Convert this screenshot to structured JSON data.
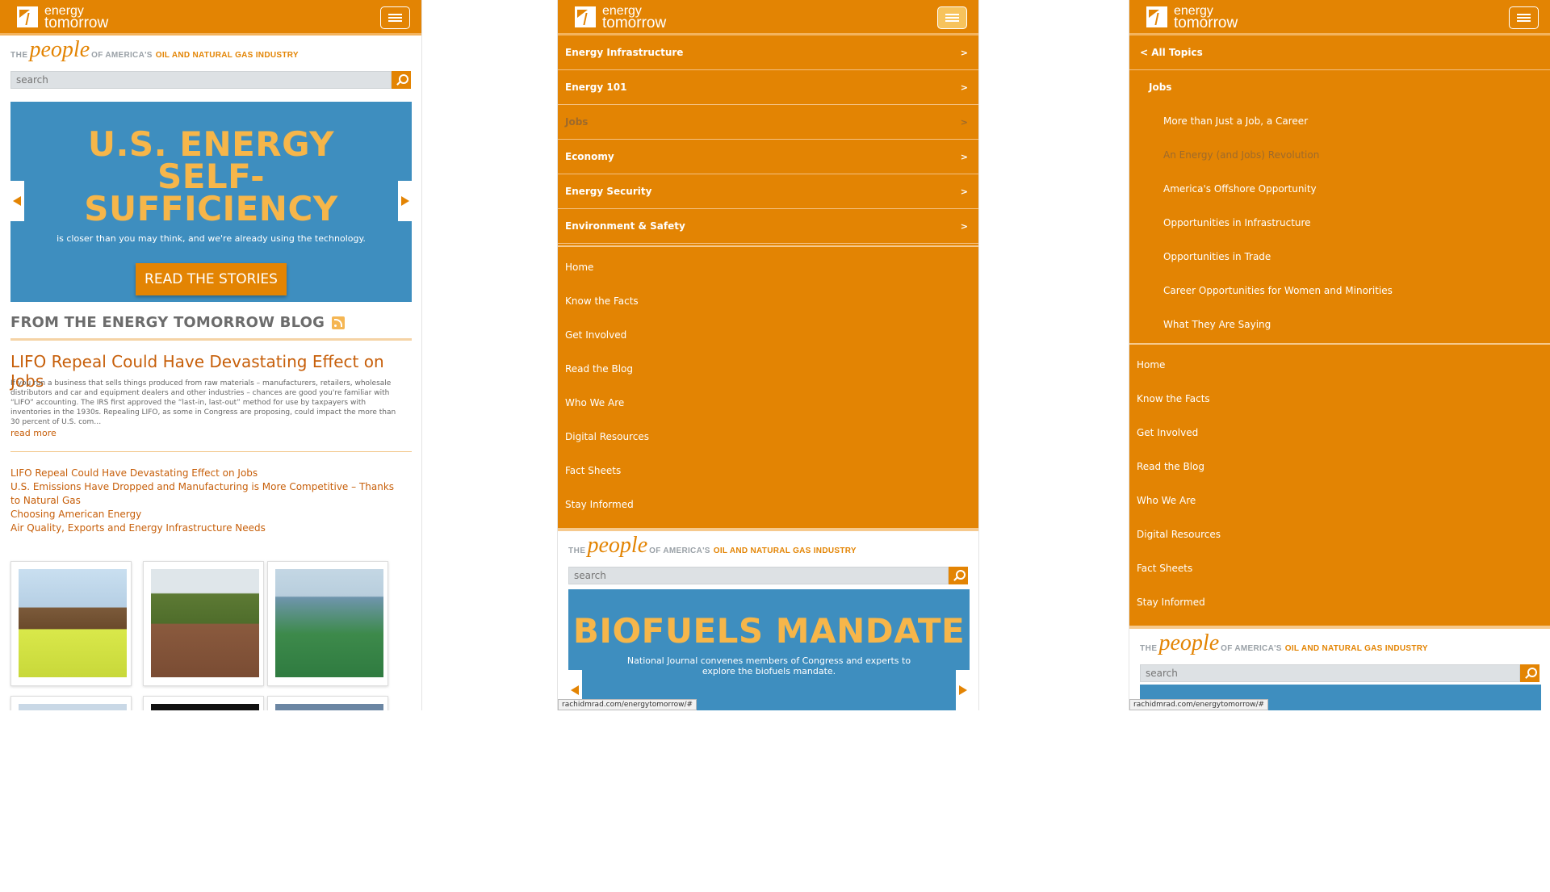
{
  "brand": {
    "line1": "energy",
    "line2": "tomorrow"
  },
  "tagline": {
    "the": "THE",
    "people": "people",
    "of": "OF AMERICA'S",
    "industry": "OIL AND NATURAL GAS INDUSTRY"
  },
  "search": {
    "placeholder": "search"
  },
  "panel1": {
    "hero": {
      "title": "U.S. ENERGY SELF-SUFFICIENCY",
      "subtitle": "is closer than you may think, and we're already using the technology.",
      "button": "READ THE STORIES"
    },
    "blog_heading": "FROM THE ENERGY TOMORROW BLOG",
    "post": {
      "title": "LIFO Repeal Could Have Devastating Effect on Jobs",
      "body": "If you run a business that sells things produced from raw materials – manufacturers, retailers, wholesale distributors and car and equipment dealers and other industries – chances are good you're familiar with “LIFO” accounting. The IRS first approved the “last-in, last-out” method for use by taxpayers with inventories in the 1930s. Repealing LIFO, as some in Congress are proposing, could impact the more than 30 percent of U.S. com…",
      "read_more": "read more"
    },
    "links": [
      "LIFO Repeal Could Have Devastating Effect on Jobs",
      "U.S. Emissions Have Dropped and Manufacturing is More Competitive – Thanks to Natural Gas",
      "Choosing American Energy",
      "Air Quality, Exports and Energy Infrastructure Needs"
    ]
  },
  "panel2": {
    "topics": [
      {
        "label": "Energy Infrastructure",
        "chev": ">"
      },
      {
        "label": "Energy 101",
        "chev": ">"
      },
      {
        "label": "Jobs",
        "chev": ">"
      },
      {
        "label": "Economy",
        "chev": ">"
      },
      {
        "label": "Energy Security",
        "chev": ">"
      },
      {
        "label": "Environment & Safety",
        "chev": ">"
      }
    ],
    "hero": {
      "title": "BIOFUELS MANDATE",
      "subtitle": "National Journal convenes members of Congress and experts to explore the biofuels mandate."
    },
    "status_url": "rachidmrad.com/energytomorrow/#"
  },
  "menu_items": [
    "Home",
    "Know the Facts",
    "Get Involved",
    "Read the Blog",
    "Who We Are",
    "Digital Resources",
    "Fact Sheets",
    "Stay Informed"
  ],
  "panel3": {
    "back": "< All Topics",
    "section": "Jobs",
    "subitems": [
      "More than Just a Job, a Career",
      "An Energy (and Jobs) Revolution",
      "America's Offshore Opportunity",
      "Opportunities in Infrastructure",
      "Opportunities in Trade",
      "Career Opportunities for Women and Minorities",
      "What They Are Saying"
    ],
    "status_url": "rachidmrad.com/energytomorrow/#"
  },
  "colors": {
    "brand_orange": "#e38403",
    "hero_blue": "#3e8ebf",
    "hero_yellow": "#f6b64a",
    "link_orange": "#c75f0a"
  }
}
